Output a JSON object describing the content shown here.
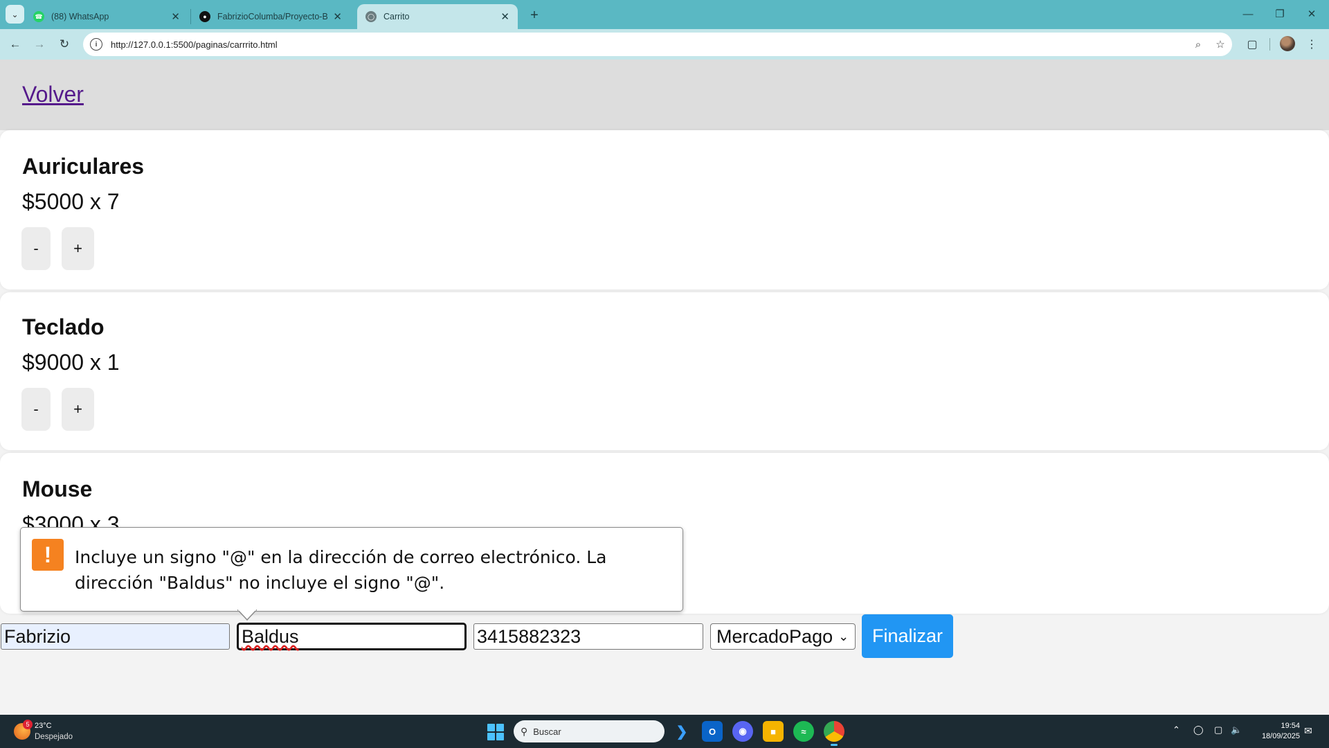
{
  "browser": {
    "tabs": [
      {
        "label": "(88) WhatsApp",
        "active": false
      },
      {
        "label": "FabrizioColumba/Proyecto-Bac",
        "active": false
      },
      {
        "label": "Carrito",
        "active": true
      }
    ],
    "url": "http://127.0.0.1:5500/paginas/carrrito.html"
  },
  "page": {
    "back_link": "Volver",
    "products": [
      {
        "name": "Auriculares",
        "price_line": "$5000 x 7"
      },
      {
        "name": "Teclado",
        "price_line": "$9000 x 1"
      },
      {
        "name": "Mouse",
        "price_line": "$3000 x 3"
      }
    ],
    "qty_minus": "-",
    "qty_plus": "+",
    "form": {
      "name_value": "Fabrizio",
      "email_value": "Baldus",
      "phone_value": "3415882323",
      "payment_selected": "MercadoPago",
      "submit_label": "Finalizar"
    },
    "validation_tooltip": {
      "icon": "warning-icon",
      "line1": "Incluye un signo \"@\" en la dirección de correo electrónico. La",
      "line2": "dirección \"Baldus\" no incluye el signo \"@\"."
    }
  },
  "taskbar": {
    "weather_temp": "23°C",
    "weather_desc": "Despejado",
    "weather_badge": "5",
    "search_placeholder": "Buscar",
    "time": "19:54",
    "date": "18/09/2025"
  },
  "colors": {
    "tab_strip": "#5ab8c3",
    "toolbar": "#c4e6ea",
    "primary_button": "#2196f3",
    "warning": "#f58220",
    "visited_link": "#551a8b"
  }
}
